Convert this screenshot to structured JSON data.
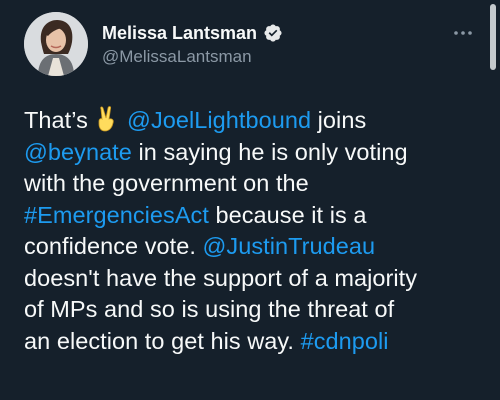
{
  "author": {
    "display_name": "Melissa Lantsman",
    "handle": "@MelissaLantsman",
    "verified": true
  },
  "tweet": {
    "lines": [
      [
        {
          "t": "text",
          "v": "That’s "
        },
        {
          "t": "emoji",
          "v": "✌"
        },
        {
          "t": "text",
          "v": " "
        },
        {
          "t": "link",
          "v": "@JoelLightbound"
        },
        {
          "t": "text",
          "v": " joins"
        }
      ],
      [
        {
          "t": "link",
          "v": "@beynate"
        },
        {
          "t": "text",
          "v": " in saying he is only voting"
        }
      ],
      [
        {
          "t": "text",
          "v": "with the government on the"
        }
      ],
      [
        {
          "t": "link",
          "v": "#EmergenciesAct"
        },
        {
          "t": "text",
          "v": " because it is a"
        }
      ],
      [
        {
          "t": "text",
          "v": "confidence vote. "
        },
        {
          "t": "link",
          "v": "@JustinTrudeau"
        }
      ],
      [
        {
          "t": "text",
          "v": "doesn't have the support of a majority"
        }
      ],
      [
        {
          "t": "text",
          "v": "of MPs and so is using the threat of"
        }
      ],
      [
        {
          "t": "text",
          "v": "an election to get his way. "
        },
        {
          "t": "link",
          "v": "#cdnpoli"
        }
      ]
    ]
  },
  "icons": {
    "verified": "verified-badge-icon",
    "more": "more-options-icon",
    "emoji": "victory-hand-emoji"
  },
  "colors": {
    "background": "#15202b",
    "text": "#f7f9f9",
    "secondary_text": "#8b98a5",
    "link": "#1d9bf0"
  }
}
